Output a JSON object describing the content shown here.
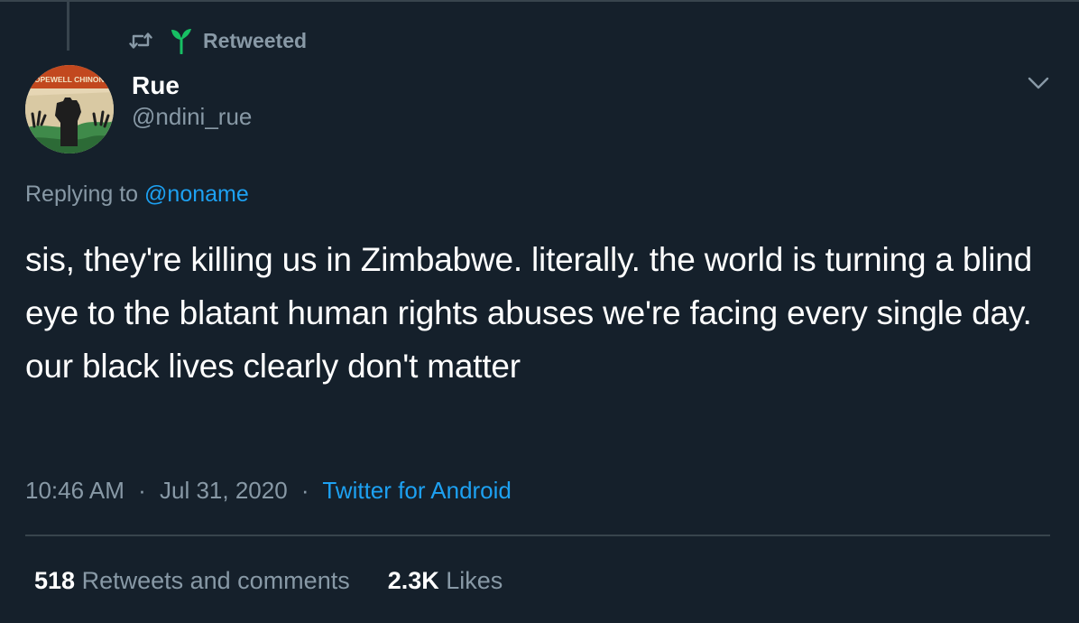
{
  "retweet": {
    "label": "Retweeted"
  },
  "user": {
    "display_name": "Rue",
    "handle": "@ndini_rue",
    "avatar_text": "HOPEWELL CHINONO"
  },
  "reply": {
    "prefix": "Replying to ",
    "mention": "@noname"
  },
  "tweet": {
    "text": "sis, they're killing us in Zimbabwe. literally. the world is turning a blind eye to the blatant human rights abuses we're facing every single day. our black lives clearly don't matter"
  },
  "meta": {
    "time": "10:46 AM",
    "date": "Jul 31, 2020",
    "separator": "·",
    "source": "Twitter for Android"
  },
  "stats": {
    "retweets_count": "518",
    "retweets_label": "Retweets and comments",
    "likes_count": "2.3K",
    "likes_label": "Likes"
  },
  "colors": {
    "background": "#15202b",
    "accent": "#1da1f2",
    "muted": "#8899a6",
    "sprout": "#17bf63"
  }
}
